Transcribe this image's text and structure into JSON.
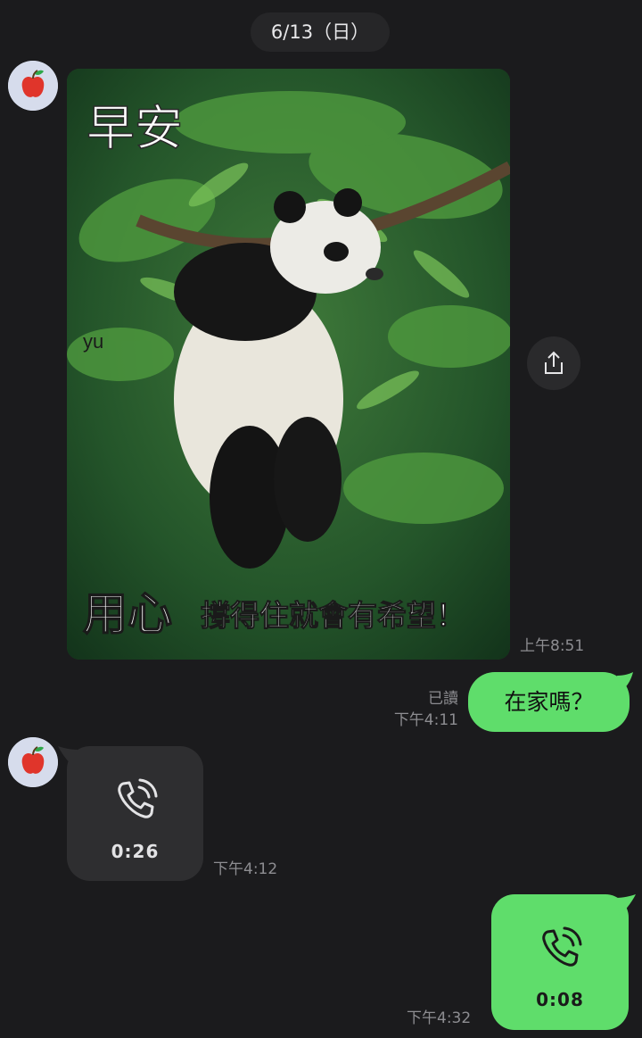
{
  "chat": {
    "date_divider": "6/13（日）",
    "messages": [
      {
        "type": "image",
        "direction": "incoming",
        "time": "上午8:51",
        "image_text": {
          "greeting": "早安",
          "watermark": "yu",
          "caption_big": "用心",
          "caption_small": "撐得住就會有希望！"
        }
      },
      {
        "type": "text",
        "direction": "outgoing",
        "text": "在家嗎？",
        "read_status": "已讀",
        "time": "下午4:11"
      },
      {
        "type": "call",
        "direction": "incoming",
        "duration": "0:26",
        "time": "下午4:12"
      },
      {
        "type": "call",
        "direction": "outgoing",
        "duration": "0:08",
        "time": "下午4:32"
      }
    ]
  },
  "icons": {
    "avatar": "apple-icon",
    "share": "share-icon",
    "call": "phone-call-icon"
  },
  "colors": {
    "background": "#1b1b1d",
    "outgoing_bubble": "#5fdd6b",
    "incoming_bubble": "#2e2e30",
    "timestamp": "#8d8d91"
  }
}
